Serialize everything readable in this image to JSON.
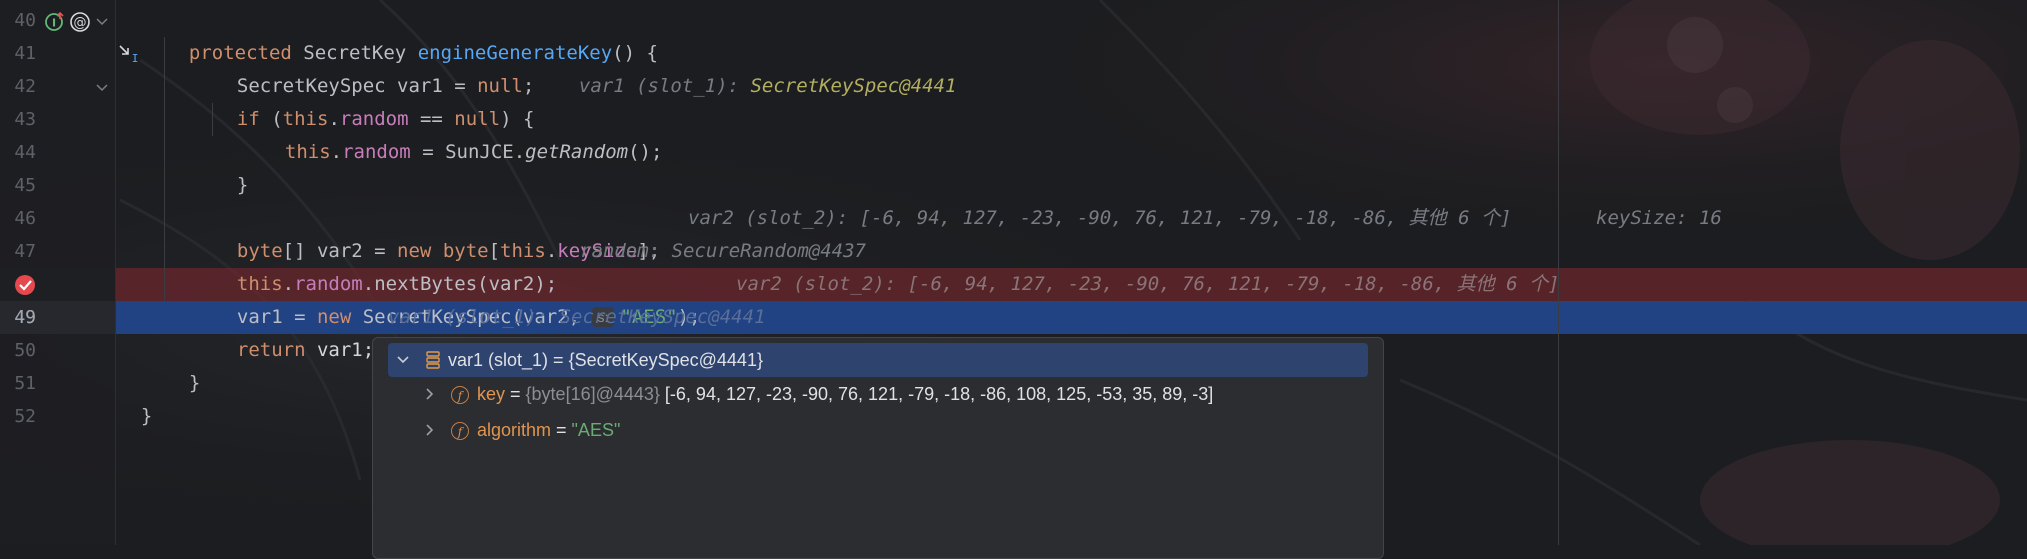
{
  "gutter": {
    "line_numbers": [
      "40",
      "41",
      "42",
      "43",
      "44",
      "45",
      "46",
      "47",
      "48",
      "49",
      "50",
      "51",
      "52"
    ]
  },
  "code": {
    "line40": {
      "kw": "protected",
      "type": " SecretKey ",
      "fn": "engineGenerateKey",
      "rest": "() {"
    },
    "line41": {
      "a": "SecretKeySpec var1 = ",
      "kw": "null",
      "b": ";"
    },
    "line41_hint": {
      "label": "var1 (slot_1): ",
      "value": "SecretKeySpec@4441"
    },
    "line42": {
      "kw1": "if",
      "a": " (",
      "kw2": "this",
      ".": ".",
      "field": "random",
      "b": " == ",
      "kw3": "null",
      "c": ") {"
    },
    "line43": {
      "kw": "this",
      "dot": ".",
      "field": "random",
      "a": " = SunJCE.",
      "m": "getRandom",
      "b": "();"
    },
    "line44": {
      "a": "}"
    },
    "line46": {
      "kw1": "byte",
      "a": "[] var2 = ",
      "kw2": "new",
      "sp": " ",
      "kw3": "byte",
      "b": "[",
      "kw4": "this",
      "dot": ".",
      "field": "keySize",
      "c": "];"
    },
    "line46_hint": "var2 (slot_2): [-6, 94, 127, -23, -90, 76, 121, -79, -18, -86, 其他 6 个]",
    "line46_hint2": "keySize: 16",
    "line47": {
      "kw": "this",
      "dot": ".",
      "field": "random",
      "a": ".nextBytes(var2);"
    },
    "line47_hint": "random: SecureRandom@4437",
    "line48": {
      "a": "var1 = ",
      "kw": "new",
      "b": " SecretKeySpec(var2, ",
      "chip": "s:",
      "str": "\"AES\"",
      "c": ");"
    },
    "line48_hint": "var2 (slot_2): [-6, 94, 127, -23, -90, 76, 121, -79, -18, -86, 其他 6 个]",
    "line49": {
      "kw": "return",
      "a": " var1;"
    },
    "line49_hint": "var1 (slot_1): SecretKeySpec@4441",
    "line50": {
      "a": "}"
    },
    "line51": {
      "a": "}"
    }
  },
  "popup": {
    "root": {
      "name": "var1 (slot_1)",
      "eq": " = ",
      "value": "{SecretKeySpec@4441}"
    },
    "children": [
      {
        "name": "key",
        "eq": " = ",
        "type": "{byte[16]@4443}",
        "value": " [-6, 94, 127, -23, -90, 76, 121, -79, -18, -86, 108, 125, -53, 35, 89, -3]"
      },
      {
        "name": "algorithm",
        "eq": " = ",
        "value": "\"AES\""
      }
    ]
  },
  "icons": {
    "line40": [
      "implements-icon",
      "override-at-icon",
      "fold-chevron-icon"
    ],
    "line41": [
      "step-into-arrow-icon"
    ],
    "line42": [
      "fold-chevron-icon"
    ],
    "line48": [
      "breakpoint-icon"
    ]
  },
  "colors": {
    "keyword": "#cf8e6d",
    "method": "#56a8f5",
    "field": "#c77dbb",
    "string": "#6aab73",
    "breakpoint_row": "#6e262c",
    "execution_row": "#214283"
  }
}
